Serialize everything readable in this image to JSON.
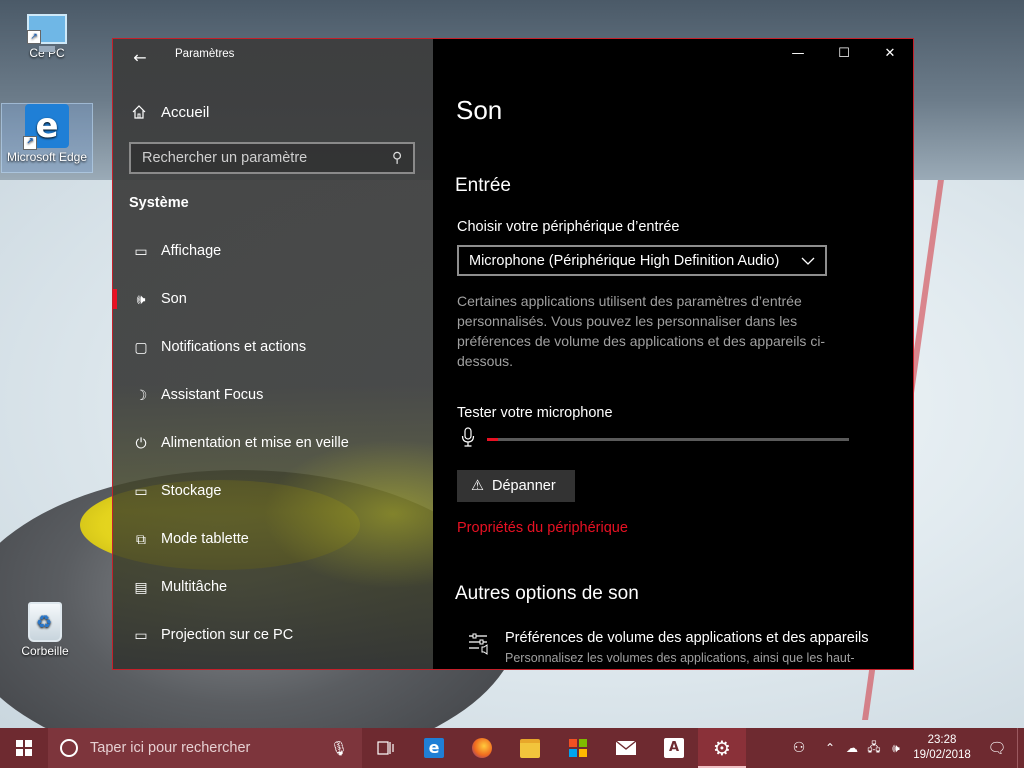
{
  "desktop": {
    "icons": [
      {
        "label": "Ce PC"
      },
      {
        "label": "Microsoft Edge"
      },
      {
        "label": "Corbeille"
      }
    ]
  },
  "window": {
    "title": "Paramètres",
    "back_glyph": "←",
    "controls": {
      "minimize": "—",
      "maximize": "☐",
      "close": "✕"
    },
    "accent_color": "#e81123"
  },
  "nav": {
    "home_label": "Accueil",
    "search_placeholder": "Rechercher un paramètre",
    "section_title": "Système",
    "items": [
      {
        "label": "Affichage",
        "icon": "monitor-icon"
      },
      {
        "label": "Son",
        "icon": "speaker-icon",
        "active": true
      },
      {
        "label": "Notifications et actions",
        "icon": "notification-icon"
      },
      {
        "label": "Assistant Focus",
        "icon": "moon-icon"
      },
      {
        "label": "Alimentation et mise en veille",
        "icon": "power-icon"
      },
      {
        "label": "Stockage",
        "icon": "storage-icon"
      },
      {
        "label": "Mode tablette",
        "icon": "tablet-icon"
      },
      {
        "label": "Multitâche",
        "icon": "multitask-icon"
      },
      {
        "label": "Projection sur ce PC",
        "icon": "projection-icon"
      }
    ]
  },
  "content": {
    "title": "Son",
    "input_section": "Entrée",
    "choose_device_label": "Choisir votre périphérique d’entrée",
    "device_selected": "Microphone (Périphérique High Definition Audio)",
    "description": "Certaines applications utilisent des paramètres d’entrée personnalisés. Vous pouvez les personnaliser dans les préférences de volume des applications et des appareils ci-dessous.",
    "test_mic_label": "Tester votre microphone",
    "mic_level": 0.03,
    "troubleshoot_button": "Dépanner",
    "device_properties_link": "Propriétés du périphérique",
    "other_options_section": "Autres options de son",
    "app_volume_title": "Préférences de volume des applications et des appareils",
    "app_volume_subtitle": "Personnalisez les volumes des applications, ainsi que les haut-"
  },
  "taskbar": {
    "search_placeholder": "Taper ici pour rechercher",
    "background_color": "#6e2a30",
    "apps": [
      {
        "name": "task-view-icon"
      },
      {
        "name": "edge-icon"
      },
      {
        "name": "firefox-icon"
      },
      {
        "name": "file-explorer-icon"
      },
      {
        "name": "store-icon"
      },
      {
        "name": "mail-icon"
      },
      {
        "name": "translate-icon"
      },
      {
        "name": "settings-icon",
        "active": true
      }
    ],
    "clock_time": "23:28",
    "clock_date": "19/02/2018"
  }
}
